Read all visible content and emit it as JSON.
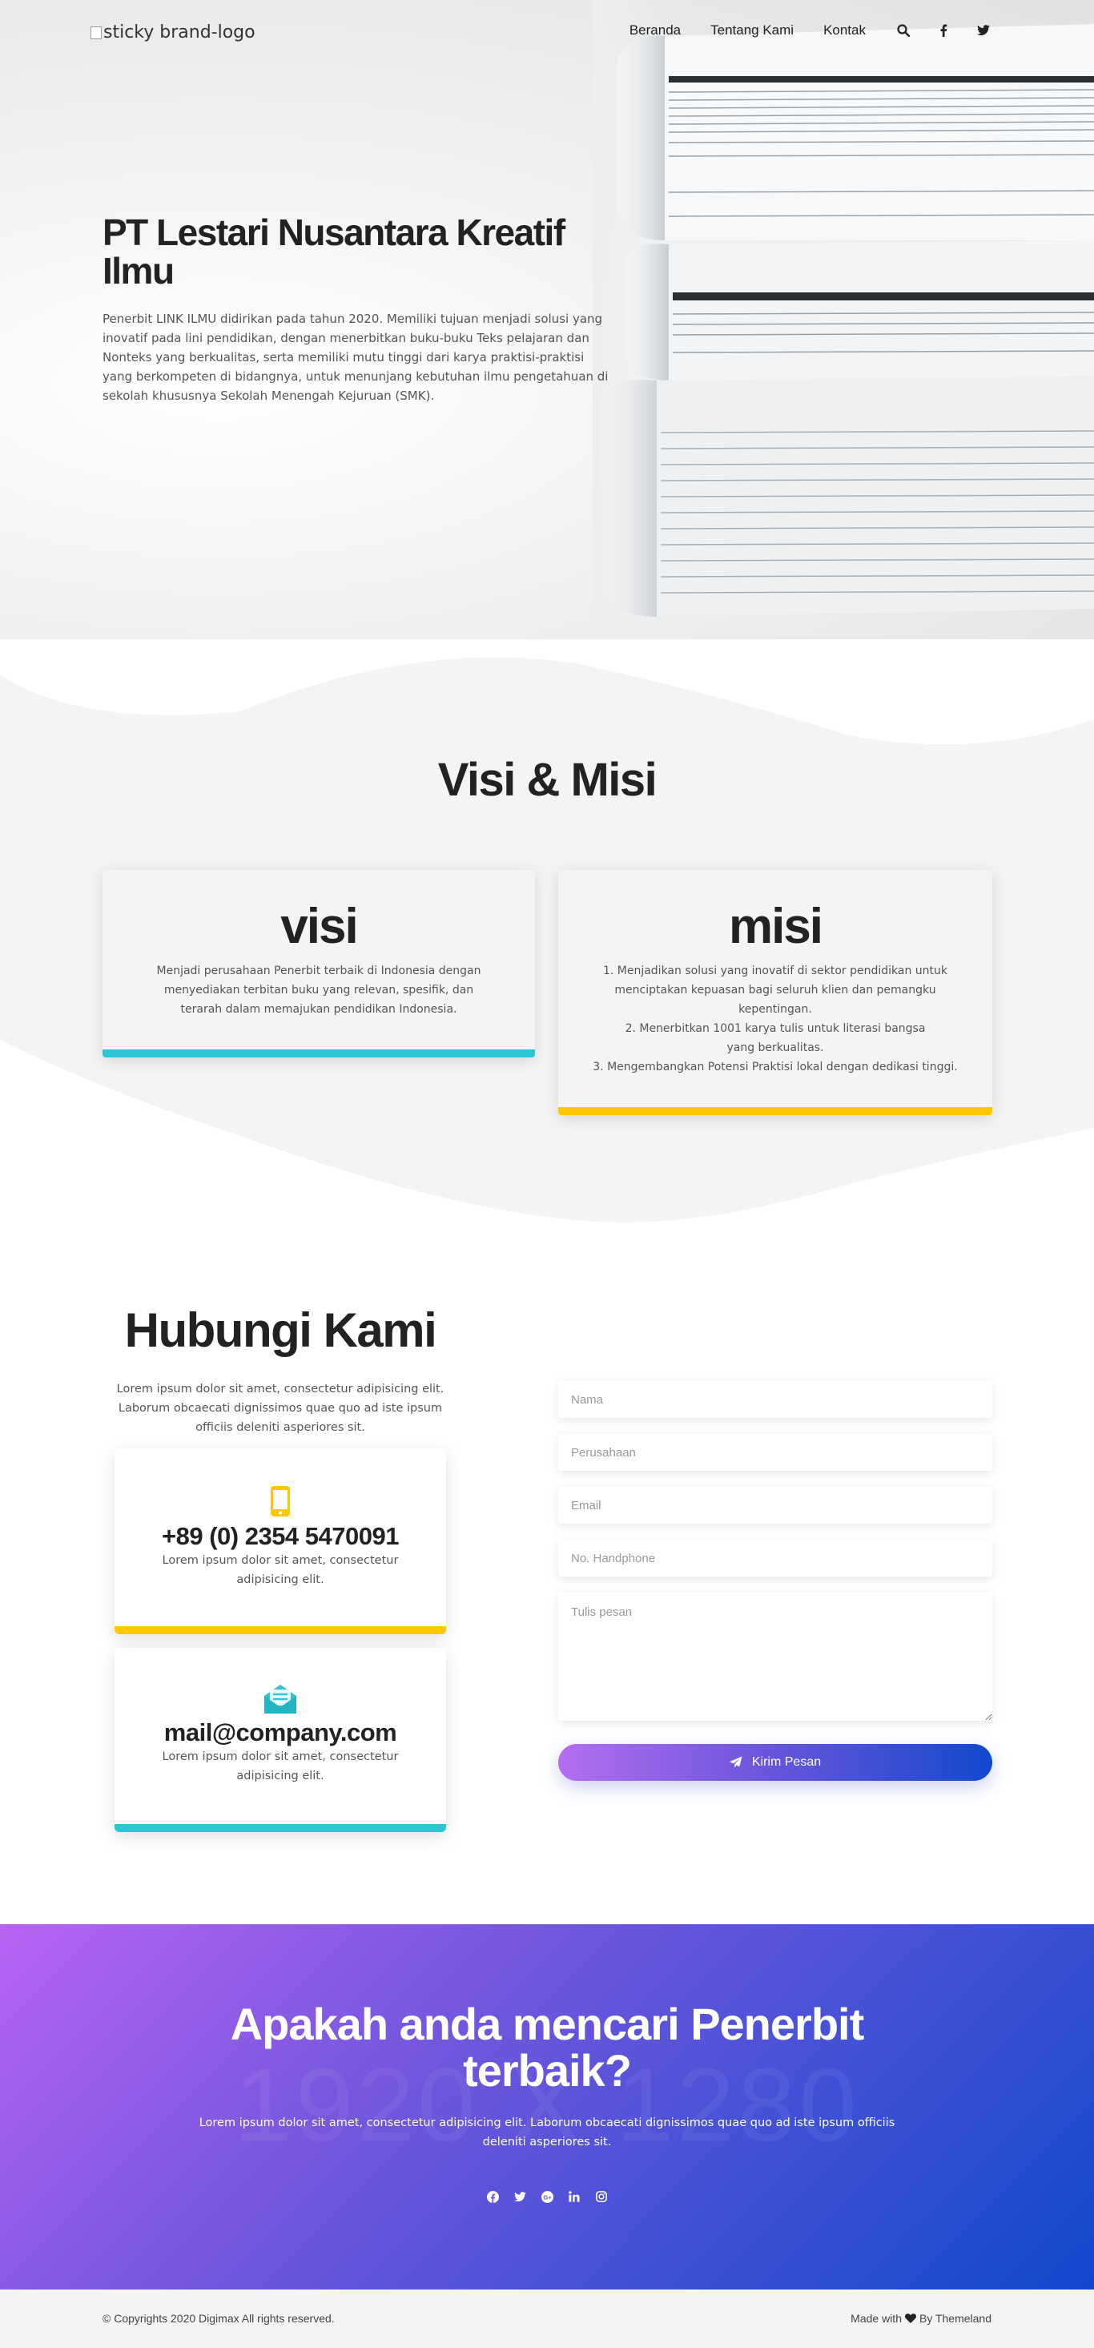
{
  "nav": {
    "logo_alt": "sticky brand-logo",
    "items": [
      {
        "label": "Beranda"
      },
      {
        "label": "Tentang Kami"
      },
      {
        "label": "Kontak"
      }
    ],
    "icons": [
      "search-icon",
      "facebook-icon",
      "twitter-icon"
    ]
  },
  "hero": {
    "title": "PT Lestari Nusantara Kreatif Ilmu",
    "text": "Penerbit LINK ILMU didirikan pada tahun 2020. Memiliki tujuan menjadi solusi yang inovatif pada lini pendidikan, dengan menerbitkan buku-buku Teks pelajaran dan Nonteks yang berkualitas, serta memiliki mutu tinggi dari karya praktisi-praktisi yang berkompeten di bidangnya, untuk menunjang kebutuhan ilmu pengetahuan di sekolah khususnya Sekolah Menengah Kejuruan (SMK)."
  },
  "visi_misi": {
    "title": "Visi & Misi",
    "visi": {
      "heading": "visi",
      "text": "Menjadi perusahaan Penerbit terbaik di Indonesia dengan menyediakan terbitan buku yang relevan, spesifik, dan terarah dalam memajukan pendidikan Indonesia."
    },
    "misi": {
      "heading": "misi",
      "items": [
        "1. Menjadikan solusi yang inovatif di sektor pendidikan untuk menciptakan kepuasan bagi seluruh klien dan pemangku kepentingan.",
        "2. Menerbitkan 1001 karya tulis untuk literasi bangsa yang berkualitas.",
        "3. Mengembangkan Potensi Praktisi lokal dengan dedikasi tinggi."
      ]
    }
  },
  "contact": {
    "title": "Hubungi Kami",
    "text": "Lorem ipsum dolor sit amet, consectetur adipisicing elit. Laborum obcaecati dignissimos quae quo ad iste ipsum officiis deleniti asperiores sit.",
    "phone": {
      "value": "+89 (0) 2354 5470091",
      "text": "Lorem ipsum dolor sit amet, consectetur adipisicing elit."
    },
    "email": {
      "value": "mail@company.com",
      "text": "Lorem ipsum dolor sit amet, consectetur adipisicing elit."
    },
    "form": {
      "name_placeholder": "Nama",
      "company_placeholder": "Perusahaan",
      "email_placeholder": "Email",
      "phone_placeholder": "No. Handphone",
      "message_placeholder": "Tulis pesan",
      "submit_label": "Kirim Pesan"
    }
  },
  "cta": {
    "title": "Apakah anda mencari Penerbit terbaik?",
    "text": "Lorem ipsum dolor sit amet, consectetur adipisicing elit. Laborum obcaecati dignissimos quae quo ad iste ipsum officiis deleniti asperiores sit.",
    "watermark": "1920 X 1280",
    "social_icons": [
      "facebook-icon",
      "twitter-icon",
      "google-plus-icon",
      "linkedin-icon",
      "instagram-icon"
    ]
  },
  "footer": {
    "copyright": "© Copyrights 2020 Digimax All rights reserved.",
    "made_with": "Made with",
    "by": "By Themeland"
  },
  "colors": {
    "accent_cyan": "#2ec5d3",
    "accent_yellow": "#ffc700",
    "gradient_start": "#b863f4",
    "gradient_end": "#1148ce"
  }
}
